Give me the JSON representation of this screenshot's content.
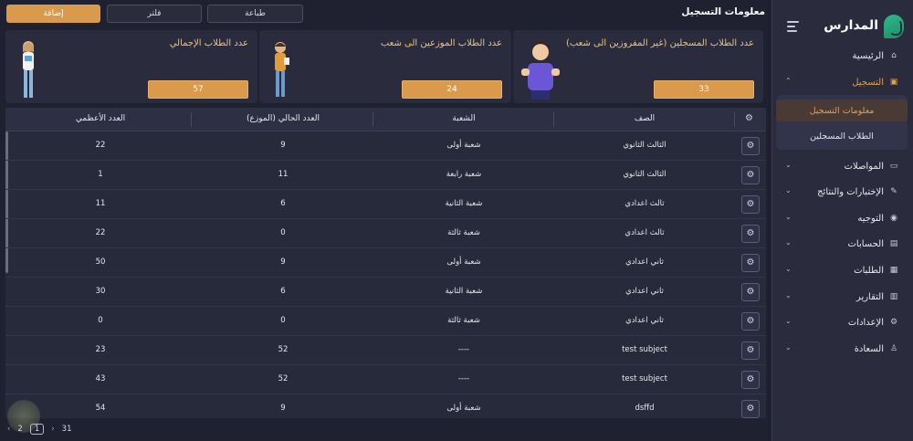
{
  "app": {
    "name": "المدارس"
  },
  "sidebar": {
    "items": [
      {
        "label": "الرئيسية",
        "icon": "home-icon"
      },
      {
        "label": "التسجيل",
        "icon": "register-icon",
        "active": true
      },
      {
        "label": "المواصلات",
        "icon": "bus-icon"
      },
      {
        "label": "الإختبارات والنتائج",
        "icon": "exam-icon"
      },
      {
        "label": "التوجيه",
        "icon": "guidance-icon"
      },
      {
        "label": "الحسابات",
        "icon": "accounts-icon"
      },
      {
        "label": "الطلبات",
        "icon": "requests-icon"
      },
      {
        "label": "التقارير",
        "icon": "reports-icon"
      },
      {
        "label": "الإعدادات",
        "icon": "settings-icon"
      },
      {
        "label": "السعادة",
        "icon": "user-icon"
      }
    ],
    "submenu": [
      {
        "label": "معلومات التسجيل",
        "selected": true
      },
      {
        "label": "الطلاب المسجلين"
      }
    ]
  },
  "header": {
    "title": "معلومات التسجيل",
    "print_label": "طباعة",
    "filter_label": "فلتر",
    "add_label": "إضافة"
  },
  "cards": [
    {
      "title": "عدد الطلاب المسجلين (غير المفروزين الى شعب)",
      "value": "33"
    },
    {
      "title": "عدد الطلاب الموزعين الى شعب",
      "value": "24"
    },
    {
      "title": "عدد الطلاب الإجمالي",
      "value": "57"
    }
  ],
  "table": {
    "columns": [
      "الصف",
      "الشعبة",
      "العدد الحالي (الموزع)",
      "العدد الأعظمي"
    ],
    "rows": [
      [
        "الثالث الثانوي",
        "شعبة أولى",
        "9",
        "22"
      ],
      [
        "الثالث الثانوي",
        "شعبة رابعة",
        "11",
        "1"
      ],
      [
        "ثالث اعدادي",
        "شعبة الثانية",
        "6",
        "11"
      ],
      [
        "ثالث اعدادي",
        "شعبة ثالثة",
        "0",
        "22"
      ],
      [
        "ثاني اعدادي",
        "شعبة أولى",
        "9",
        "50"
      ],
      [
        "ثاني اعدادي",
        "شعبة الثانية",
        "6",
        "30"
      ],
      [
        "ثاني اعدادي",
        "شعبة ثالثة",
        "0",
        "0"
      ],
      [
        "test subject",
        "----",
        "52",
        "23"
      ],
      [
        "test subject",
        "----",
        "52",
        "43"
      ],
      [
        "dsffd",
        "شعبة أولى",
        "9",
        "54"
      ]
    ]
  },
  "pagination": {
    "pages": [
      "31",
      "1",
      "2"
    ],
    "current": "1"
  },
  "colors": {
    "accent": "#d99a4c",
    "accent_text": "#ecc27d",
    "bg": "#1f2130",
    "panel": "#2a2c3e"
  }
}
